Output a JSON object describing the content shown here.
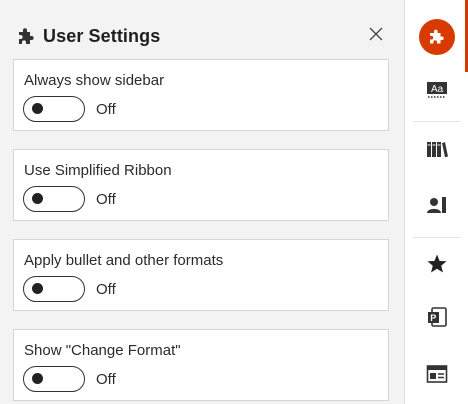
{
  "panel": {
    "title": "User Settings",
    "header_icon": "puzzle-icon",
    "close_icon": "close-icon"
  },
  "settings": [
    {
      "label": "Always show sidebar",
      "state": "Off"
    },
    {
      "label": "Use Simplified Ribbon",
      "state": "Off"
    },
    {
      "label": "Apply bullet and other formats",
      "state": "Off"
    },
    {
      "label": "Show \"Change Format\"",
      "state": "Off"
    }
  ],
  "rail": {
    "items": [
      {
        "icon": "addin-logo-icon",
        "active": true
      },
      {
        "icon": "text-styles-icon"
      },
      {
        "icon": "library-icon"
      },
      {
        "icon": "user-management-icon"
      },
      {
        "icon": "favorites-star-icon"
      },
      {
        "icon": "powerpoint-icon"
      },
      {
        "icon": "layout-icon"
      }
    ]
  },
  "colors": {
    "accent": "#d83b01",
    "panel_background": "#f3f3f3",
    "card_background": "#ffffff"
  }
}
